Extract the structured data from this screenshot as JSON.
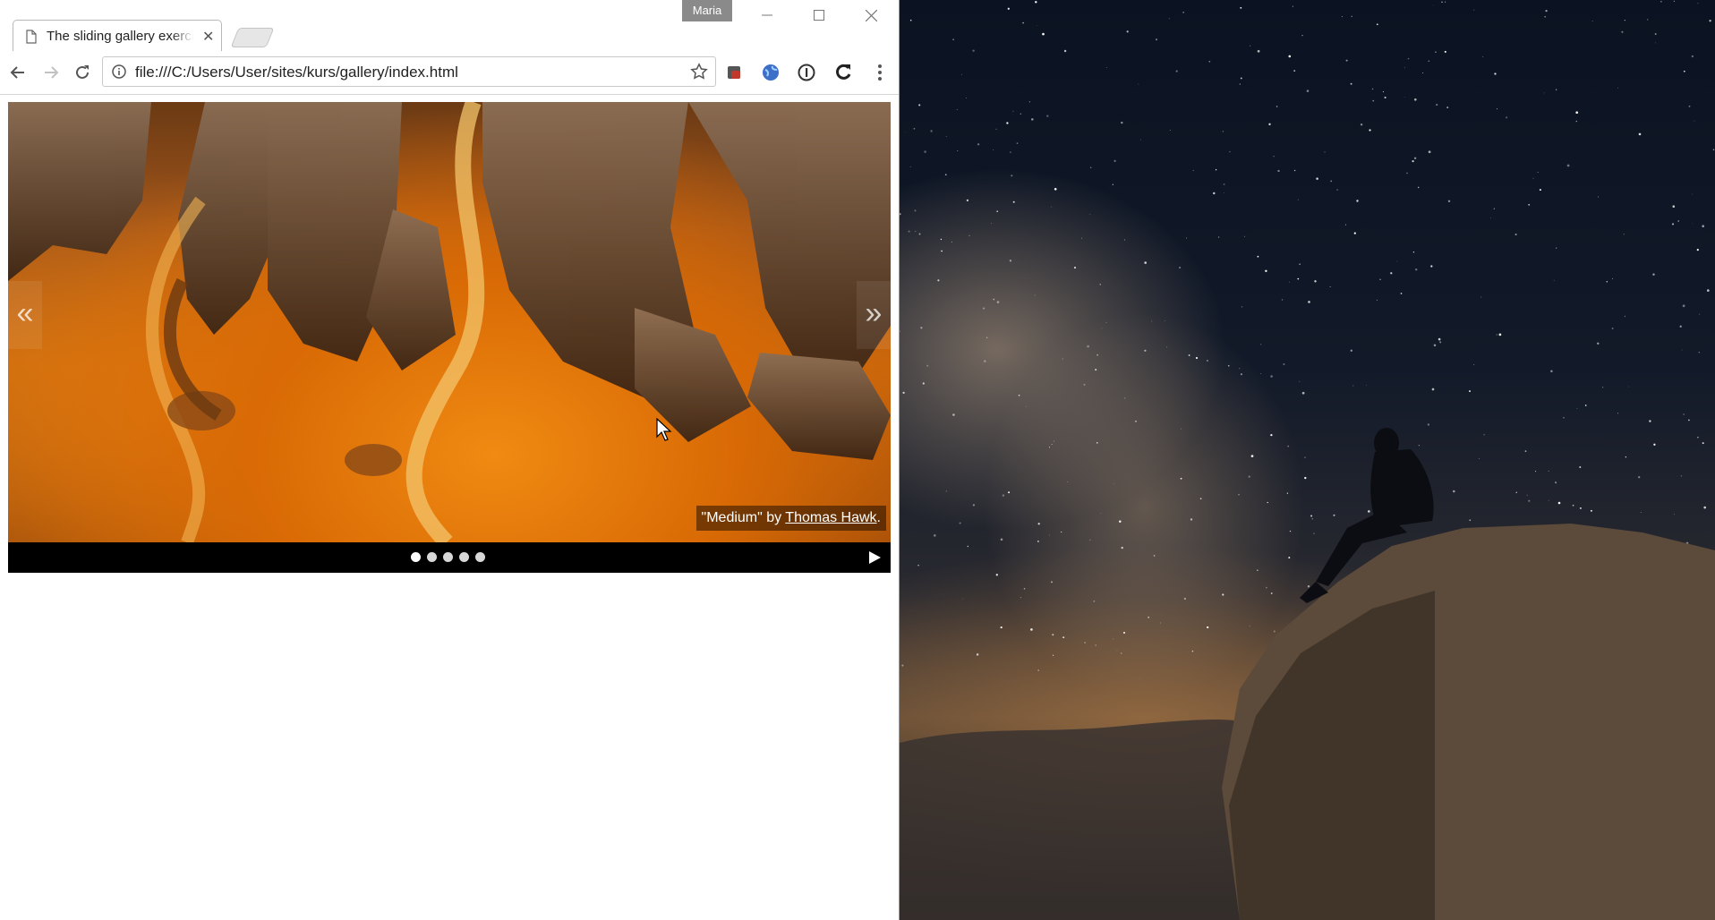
{
  "browser": {
    "tab": {
      "title": "The sliding gallery exercise"
    },
    "profile_name": "Maria",
    "address_bar": {
      "url": "file:///C:/Users/User/sites/kurs/gallery/index.html"
    }
  },
  "gallery": {
    "prev_label": "«",
    "next_label": "»",
    "caption": {
      "quote": "\"Medium\" by ",
      "author": "Thomas Hawk",
      "suffix": "."
    },
    "slide_count": 5,
    "active_slide": 1
  },
  "icons": {
    "page": "page-icon",
    "close": "close-icon",
    "minimize": "minimize-icon",
    "maximize": "maximize-icon",
    "back": "back-arrow-icon",
    "forward": "forward-arrow-icon",
    "reload": "reload-icon",
    "info": "info-icon",
    "bookmark": "star-icon",
    "menu": "kebab-menu-icon",
    "play": "play-icon",
    "cursor": "mouse-cursor-icon"
  },
  "colors": {
    "desert_orange": "#e07a10",
    "caption_bg": "rgba(0,0,0,0.45)",
    "night_sky": "#0b1322"
  }
}
